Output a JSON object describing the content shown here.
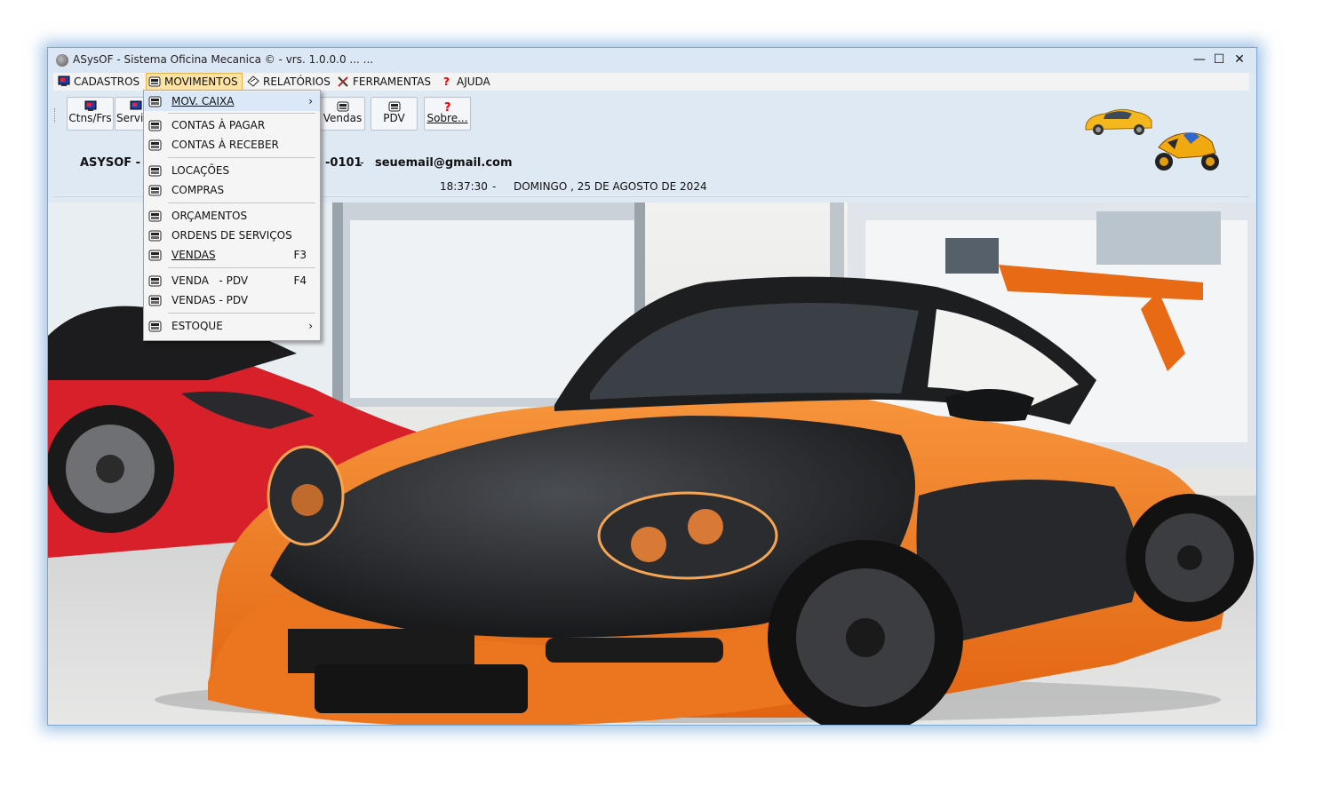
{
  "window": {
    "title": "ASysOF - Sistema Oficina Mecanica © - vrs. 1.0.0.0 ... ...",
    "minimize_glyph": "—",
    "maximize_glyph": "☐",
    "close_glyph": "✕"
  },
  "menubar": {
    "items": [
      {
        "label": "CADASTROS",
        "icon": "cadastros-icon"
      },
      {
        "label": "MOVIMENTOS",
        "icon": "movimentos-icon",
        "active": true
      },
      {
        "label": "RELATÓRIOS",
        "icon": "relatorios-icon"
      },
      {
        "label": "FERRAMENTAS",
        "icon": "ferramentas-icon"
      },
      {
        "label": "AJUDA",
        "icon": "help-icon"
      }
    ]
  },
  "toolbar": {
    "buttons": [
      {
        "label": "Ctns/Frs",
        "icon": "contacts-icon"
      },
      {
        "label": "Servi",
        "icon": "services-icon"
      },
      {
        "label": "Vendas",
        "icon": "sales-icon"
      },
      {
        "label": "PDV",
        "icon": "pdv-icon"
      },
      {
        "label": "Sobre...",
        "icon": "help-icon"
      }
    ]
  },
  "info": {
    "company_prefix": "ASYSOF - O",
    "phone_suffix": "-0101",
    "separator": "-",
    "email": "seuemail@gmail.com",
    "time": "18:37:30",
    "date": "DOMINGO , 25 DE AGOSTO DE 2024"
  },
  "dropdown": {
    "items": [
      {
        "label": "MOV. CAIXA",
        "submenu": true,
        "highlighted": true
      },
      {
        "label": "CONTAS À PAGAR"
      },
      {
        "label": "CONTAS À RECEBER"
      },
      {
        "label": "LOCAÇÕES"
      },
      {
        "label": "COMPRAS"
      },
      {
        "label": "ORÇAMENTOS"
      },
      {
        "label": "ORDENS DE SERVIÇOS"
      },
      {
        "label": "VENDAS",
        "shortcut": "F3"
      },
      {
        "label": "VENDA   - PDV",
        "shortcut": "F4"
      },
      {
        "label": "VENDAS - PDV"
      },
      {
        "label": "ESTOQUE",
        "submenu": true
      }
    ],
    "submenu_arrow": "›"
  },
  "colors": {
    "window_border": "#7aa7d4",
    "menu_active_bg": "#fde3a4",
    "menu_active_border": "#e8b44d",
    "car_orange": "#f07a1c",
    "car_red": "#d8202a"
  }
}
